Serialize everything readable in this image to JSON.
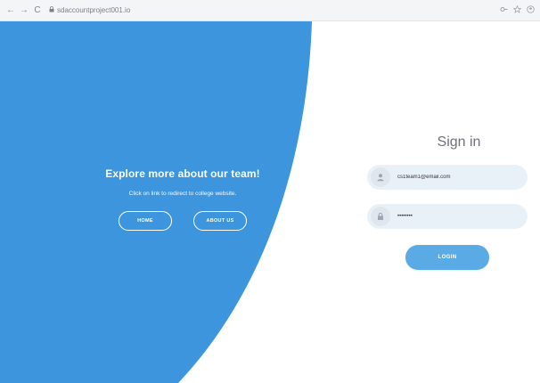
{
  "browser": {
    "url": "sdaccountproject001.io",
    "back_icon": "←",
    "forward_icon": "→",
    "reload_icon": "C",
    "lock_icon": "🔒"
  },
  "hero": {
    "title": "Explore more about our team!",
    "subtitle": "Click on link to redirect to college website.",
    "home_label": "HOME",
    "about_label": "ABOUT US",
    "color": "#3d95dd"
  },
  "signin": {
    "title": "Sign in",
    "email_value": "cs1team1@email.com",
    "password_value": "••••••••",
    "login_label": "LOGIN",
    "field_bg": "#e9f1f8",
    "button_color": "#5aaae5"
  }
}
